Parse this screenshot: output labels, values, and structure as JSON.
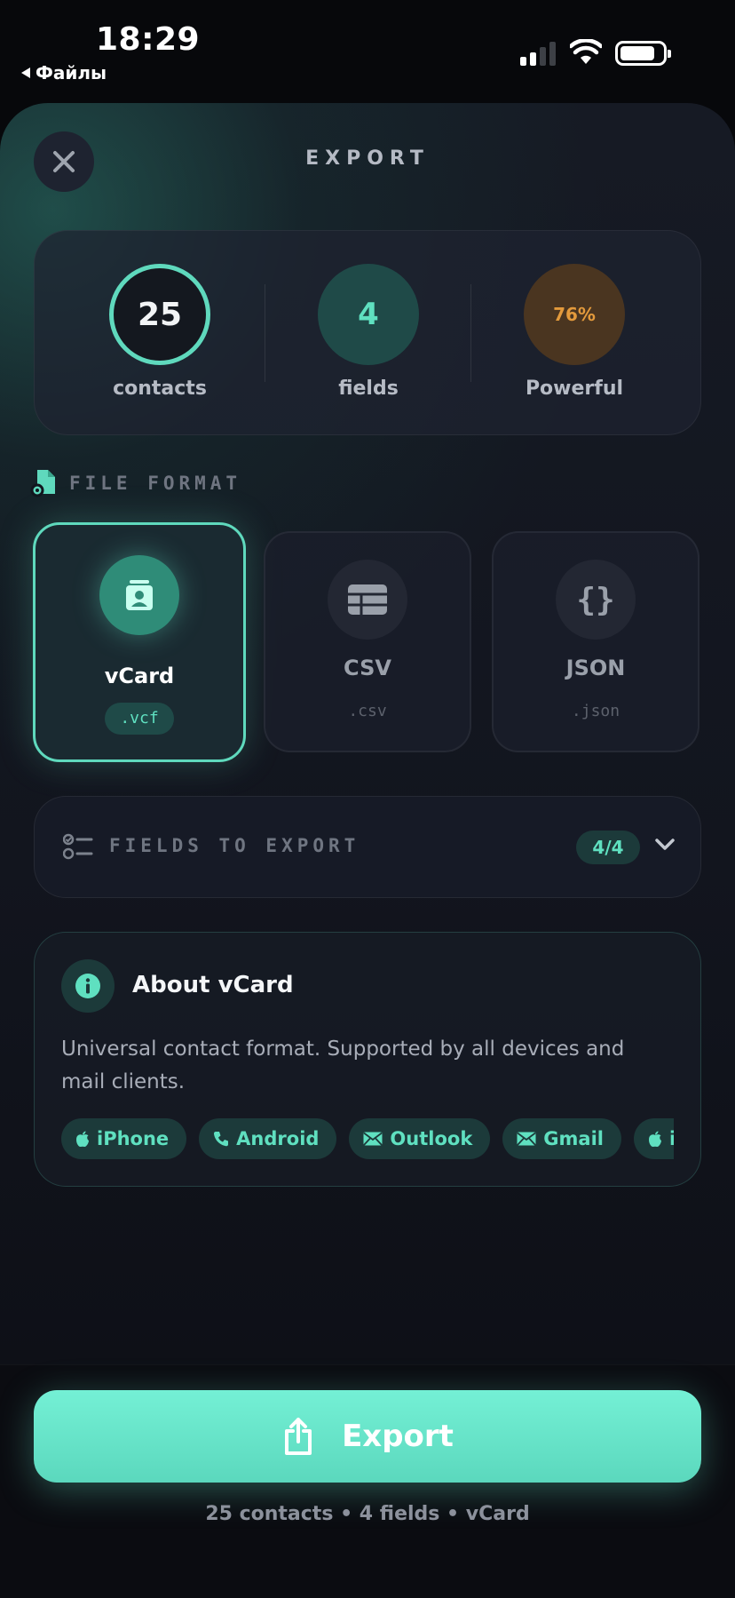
{
  "status_bar": {
    "time": "18:29",
    "back_label": "Файлы"
  },
  "header": {
    "title": "EXPORT",
    "close_icon": "close-icon"
  },
  "stats": [
    {
      "value": "25",
      "label": "contacts",
      "color": "#5fd9bd"
    },
    {
      "value": "4",
      "label": "fields",
      "color": "#5fe0c0"
    },
    {
      "value": "76%",
      "label": "Powerful",
      "color": "#e39a3c"
    }
  ],
  "file_format": {
    "section_title": "FILE FORMAT",
    "options": [
      {
        "name": "vCard",
        "ext": ".vcf",
        "selected": true,
        "icon": "contact-card-icon"
      },
      {
        "name": "CSV",
        "ext": ".csv",
        "selected": false,
        "icon": "table-icon"
      },
      {
        "name": "JSON",
        "ext": ".json",
        "selected": false,
        "icon": "curly-braces-icon"
      }
    ]
  },
  "fields_to_export": {
    "label": "FIELDS TO EXPORT",
    "count": "4/4"
  },
  "about": {
    "title": "About vCard",
    "description": "Universal contact format. Supported by all devices and mail clients.",
    "chips": [
      {
        "label": "iPhone",
        "icon": "apple-icon"
      },
      {
        "label": "Android",
        "icon": "phone-icon"
      },
      {
        "label": "Outlook",
        "icon": "mail-icon"
      },
      {
        "label": "Gmail",
        "icon": "mail-icon"
      },
      {
        "label": "iCloud",
        "icon": "apple-icon"
      }
    ]
  },
  "export_button": {
    "label": "Export"
  },
  "summary": "25 contacts • 4 fields • vCard",
  "colors": {
    "accent": "#5fd9bd",
    "warning": "#e39a3c",
    "background": "#07080b"
  }
}
